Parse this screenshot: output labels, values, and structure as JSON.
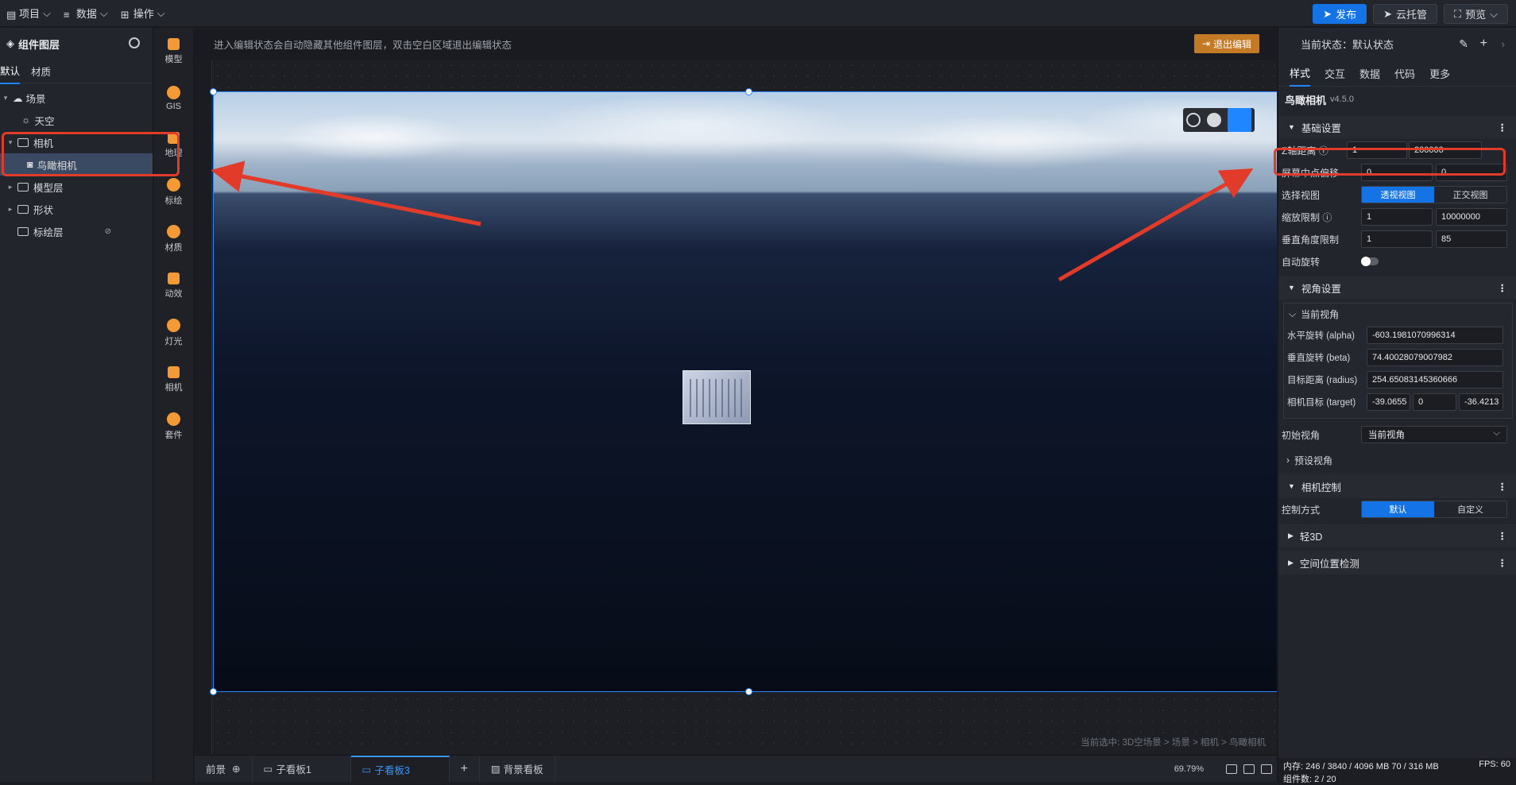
{
  "topbar": {
    "menus": [
      {
        "icon": "file-icon",
        "label": "项目"
      },
      {
        "icon": "database-icon",
        "label": "数据"
      },
      {
        "icon": "grid-icon",
        "label": "操作"
      }
    ],
    "publish_label": "发布",
    "cloud_label": "云托管",
    "preview_label": "预览"
  },
  "layers": {
    "title": "组件图层",
    "tabs": [
      "默认",
      "材质"
    ],
    "tree": [
      {
        "label": "场景",
        "depth": 0,
        "icon": "cloud-icon",
        "arrow": "▾"
      },
      {
        "label": "天空",
        "depth": 1,
        "icon": "sky-icon",
        "arrow": ""
      },
      {
        "label": "相机",
        "depth": 1,
        "icon": "folder-icon",
        "arrow": "▾"
      },
      {
        "label": "鸟瞰相机",
        "depth": 2,
        "icon": "camera-icon",
        "arrow": "",
        "selected": true
      },
      {
        "label": "模型层",
        "depth": 1,
        "icon": "folder-icon",
        "arrow": "▸"
      },
      {
        "label": "形状",
        "depth": 1,
        "icon": "folder-icon",
        "arrow": "▸"
      },
      {
        "label": "标绘层",
        "depth": 1,
        "icon": "folder-icon",
        "arrow": "",
        "hidden": true
      }
    ]
  },
  "iconbar": [
    {
      "label": "模型",
      "icon": "model-icon"
    },
    {
      "label": "GIS",
      "icon": "gis-icon"
    },
    {
      "label": "地理",
      "icon": "geo-icon"
    },
    {
      "label": "标绘",
      "icon": "marker-icon"
    },
    {
      "label": "材质",
      "icon": "material-icon"
    },
    {
      "label": "动效",
      "icon": "effect-icon"
    },
    {
      "label": "灯光",
      "icon": "light-icon"
    },
    {
      "label": "相机",
      "icon": "camera-icon"
    },
    {
      "label": "套件",
      "icon": "kit-icon"
    }
  ],
  "canvas": {
    "hint": "进入编辑状态会自动隐藏其他组件图层，双击空白区域退出编辑状态",
    "exit_label": "退出编辑",
    "selection_path": "当前选中: 3D空场景 > 场景 > 相机 > 鸟瞰相机"
  },
  "bottom": {
    "tabs": [
      {
        "label": "前景",
        "active": false
      },
      {
        "label": "子看板1",
        "active": false
      },
      {
        "label": "子看板3",
        "active": true
      },
      {
        "label": "背景看板",
        "active": false
      }
    ],
    "add_label": "+",
    "zoom": "69.79%"
  },
  "props": {
    "state_label": "当前状态：默认状态",
    "tabs": [
      "样式",
      "交互",
      "数据",
      "代码",
      "更多"
    ],
    "component_title": "鸟瞰相机",
    "version": "v4.5.0",
    "basic": {
      "title": "基础设置",
      "z_label": "Z轴距离",
      "z_min": "1",
      "z_max": "200000",
      "offset_label": "屏幕中点偏移",
      "offset_x": "0",
      "offset_y": "0",
      "view_label": "选择视图",
      "view_options": [
        "透视视图",
        "正交视图"
      ],
      "zoom_label": "缩放限制",
      "zoom_min": "1",
      "zoom_max": "10000000",
      "angle_label": "垂直角度限制",
      "angle_min": "1",
      "angle_max": "85",
      "auto_rotate_label": "自动旋转"
    },
    "view": {
      "title": "视角设置",
      "current_label": "当前视角",
      "alpha_label": "水平旋转 (alpha)",
      "alpha": "-603.1981070996314",
      "beta_label": "垂直旋转 (beta)",
      "beta": "74.40028079007982",
      "radius_label": "目标距离 (radius)",
      "radius": "254.65083145360666",
      "target_label": "相机目标 (target)",
      "target_x": "-39.0655",
      "target_y": "0",
      "target_z": "-36.4213",
      "initial_label": "初始视角",
      "initial_value": "当前视角",
      "preset_label": "预设视角"
    },
    "control": {
      "title": "相机控制",
      "mode_label": "控制方式",
      "mode_options": [
        "默认",
        "自定义"
      ]
    },
    "light3d_title": "轻3D",
    "spatial_title": "空间位置检测",
    "status": {
      "memory": "内存: 246 / 3840 / 4096 MB 70 / 316 MB",
      "fps": "FPS: 60",
      "components": "组件数: 2 / 20"
    }
  },
  "colors": {
    "accent": "#1474e6",
    "annotation": "#e23b2a",
    "exit": "#c47a25"
  }
}
